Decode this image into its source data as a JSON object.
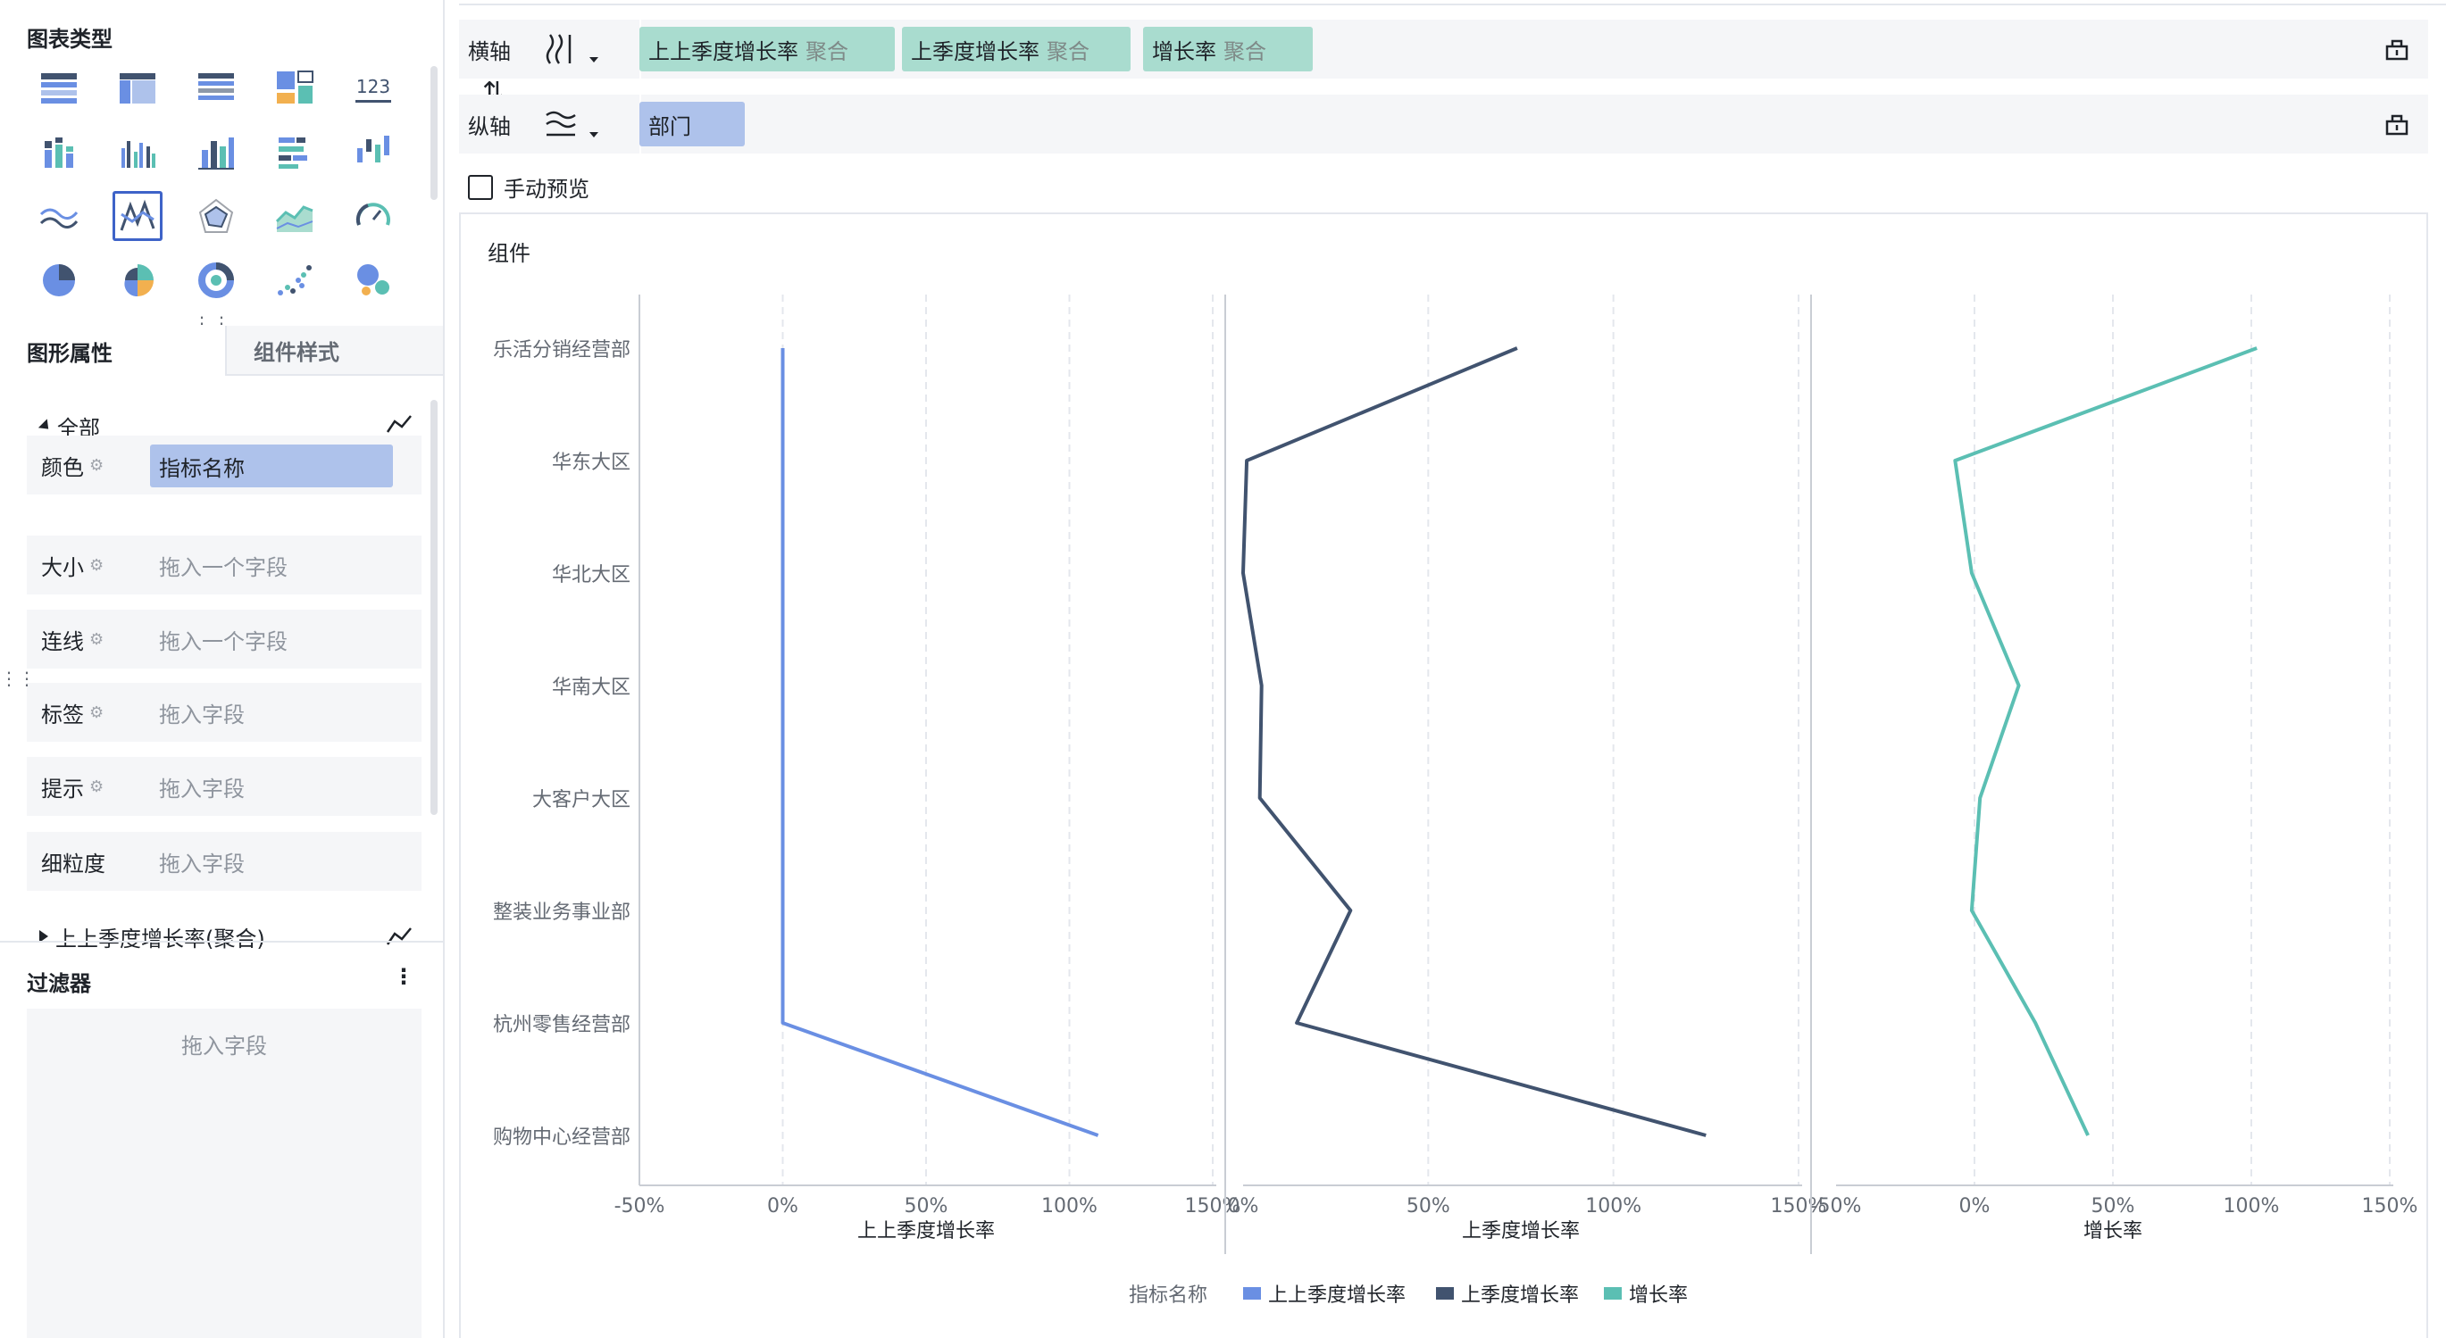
{
  "left": {
    "chart_type_title": "图表类型",
    "tabs": {
      "active": "图形属性",
      "inactive": "组件样式"
    },
    "group": {
      "all": "全部",
      "collapsed": "上上季度增长率(聚合)"
    },
    "props": [
      {
        "label": "颜色",
        "value": "指标名称",
        "filled": true,
        "gear": true
      },
      {
        "label": "大小",
        "value": "拖入一个字段",
        "filled": false,
        "gear": true
      },
      {
        "label": "连线",
        "value": "拖入一个字段",
        "filled": false,
        "gear": true
      },
      {
        "label": "标签",
        "value": "拖入字段",
        "filled": false,
        "gear": true
      },
      {
        "label": "提示",
        "value": "拖入字段",
        "filled": false,
        "gear": true
      },
      {
        "label": "细粒度",
        "value": "拖入字段",
        "filled": false,
        "gear": false
      }
    ],
    "filter": {
      "title": "过滤器",
      "placeholder": "拖入字段"
    }
  },
  "axes": {
    "x_label": "横轴",
    "y_label": "纵轴",
    "x_fields": [
      {
        "name": "上上季度增长率",
        "agg": "聚合"
      },
      {
        "name": "上季度增长率",
        "agg": "聚合"
      },
      {
        "name": "增长率",
        "agg": "聚合"
      }
    ],
    "y_fields": [
      {
        "name": "部门"
      }
    ]
  },
  "manual_preview": "手动预览",
  "component_title": "组件",
  "colors": {
    "s1": "#6a8fe3",
    "s2": "#41536f",
    "s3": "#5bbfb3",
    "pill_green": "#a9dccf",
    "pill_blue": "#aec2eb"
  },
  "chart_data": {
    "type": "line",
    "orientation": "horizontal-values",
    "categories": [
      "乐活分销经营部",
      "华东大区",
      "华北大区",
      "华南大区",
      "大客户大区",
      "整装业务事业部",
      "杭州零售经营部",
      "购物中心经营部"
    ],
    "panels": [
      {
        "name": "上上季度增长率",
        "xlabel": "上上季度增长率",
        "xlim": [
          -0.5,
          1.5
        ],
        "ticks": [
          -0.5,
          0,
          0.5,
          1,
          1.5
        ],
        "tick_labels": [
          "-50%",
          "0%",
          "50%",
          "100%",
          "150%"
        ],
        "values": [
          0,
          0,
          0,
          0,
          0,
          0,
          0,
          1.1
        ],
        "color": "#6a8fe3"
      },
      {
        "name": "上季度增长率",
        "xlabel": "上季度增长率",
        "xlim": [
          0,
          1.5
        ],
        "ticks": [
          0,
          0.5,
          1,
          1.5
        ],
        "tick_labels": [
          "0%",
          "50%",
          "100%",
          "150%"
        ],
        "values": [
          0.74,
          0.01,
          0.0,
          0.05,
          0.045,
          0.29,
          0.145,
          1.25
        ],
        "color": "#41536f"
      },
      {
        "name": "增长率",
        "xlabel": "增长率",
        "xlim": [
          -0.5,
          1.5
        ],
        "ticks": [
          -0.5,
          0,
          0.5,
          1,
          1.5
        ],
        "tick_labels": [
          "-50%",
          "0%",
          "50%",
          "100%",
          "150%"
        ],
        "values": [
          1.02,
          -0.07,
          -0.01,
          0.16,
          0.02,
          -0.01,
          0.22,
          0.41
        ],
        "color": "#5bbfb3"
      }
    ],
    "legend": {
      "title": "指标名称",
      "items": [
        "上上季度增长率",
        "上季度增长率",
        "增长率"
      ],
      "position": "bottom-center"
    },
    "grid": true
  }
}
